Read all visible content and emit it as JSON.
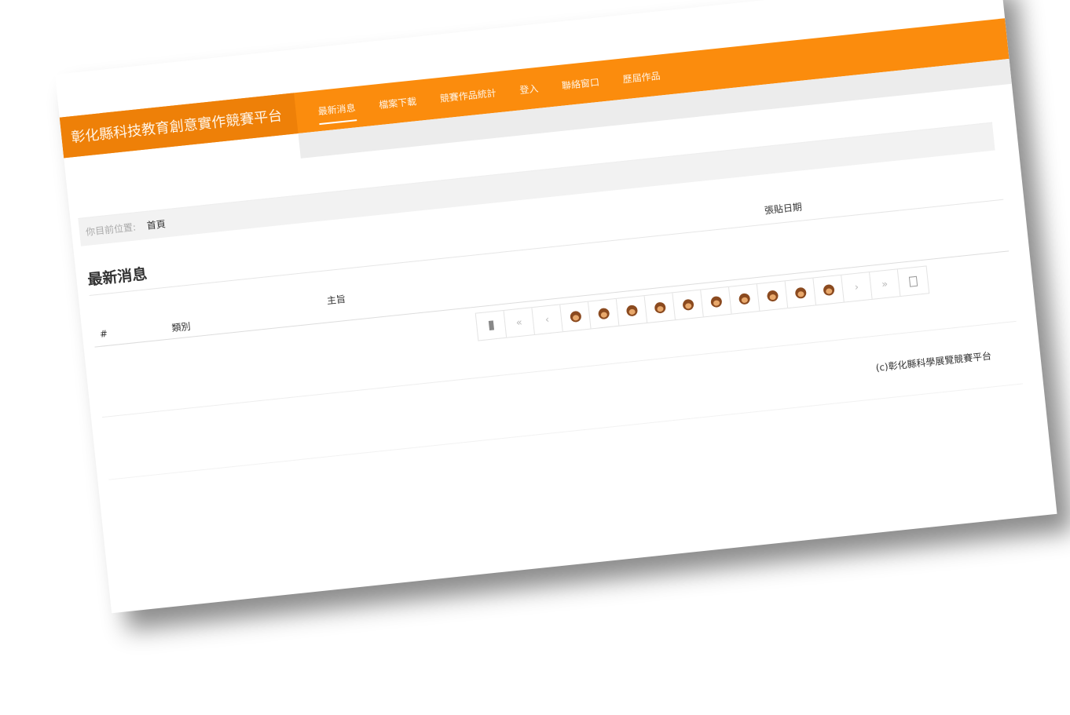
{
  "header": {
    "brand": "彰化縣科技教育創意實作競賽平台",
    "nav": [
      {
        "label": "最新消息",
        "active": true
      },
      {
        "label": "檔案下載",
        "active": false
      },
      {
        "label": "競賽作品統計",
        "active": false
      },
      {
        "label": "登入",
        "active": false
      },
      {
        "label": "聯絡窗口",
        "active": false
      },
      {
        "label": "歷屆作品",
        "active": false
      }
    ]
  },
  "breadcrumb": {
    "label": "你目前位置:",
    "current": "首頁"
  },
  "main": {
    "title": "最新消息",
    "columns": {
      "num": "#",
      "category": "類別",
      "subject": "主旨",
      "date": "張貼日期"
    }
  },
  "pager": {
    "first": "▮",
    "prev_double": "«",
    "prev": "‹",
    "pages": [
      "face-icon",
      "face-icon",
      "face-icon",
      "face-icon",
      "face-icon",
      "face-icon",
      "face-icon",
      "face-icon",
      "face-icon",
      "face-icon"
    ],
    "next": "›",
    "next_double": "»",
    "last": "□"
  },
  "footer": {
    "copyright": "(c)彰化縣科學展覽競賽平台"
  },
  "colors": {
    "accent": "#fb8c0d",
    "brand_bg": "#ee8008"
  }
}
